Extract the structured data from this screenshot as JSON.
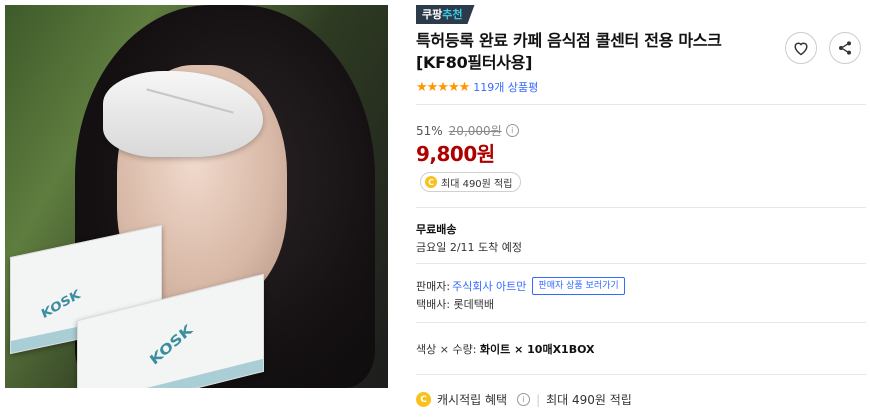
{
  "product_image": {
    "brand_text": "KOSK"
  },
  "badge": {
    "prefix": "쿠팡",
    "suffix": "추천"
  },
  "title": "특허등록 완료 카페 음식점 콜센터 전용 마스크 [KF80필터사용]",
  "actions": {
    "heart_icon": "heart-icon",
    "share_icon": "share-icon"
  },
  "rating": {
    "stars": "★★★★★",
    "review_count": "119개 상품평",
    "star_color": "#ff9600"
  },
  "price": {
    "discount_rate": "51%",
    "original_price": "20,000원",
    "info_icon": "ⓘ",
    "sale_price": "9,800원",
    "sale_color": "#ae0000"
  },
  "reward": {
    "coin_glyph": "C",
    "text": "최대 490원 적립"
  },
  "shipping": {
    "label": "무료배송",
    "arrival": "금요일 2/11 도착 예정"
  },
  "seller": {
    "label": "판매자:",
    "name": "주식회사 아트만",
    "button": "판매자 상품 보러가기",
    "courier": "택배사: 롯데택배"
  },
  "option": {
    "label": "색상 × 수량:",
    "value": "화이트 × 10매X1BOX"
  },
  "cash": {
    "coin_glyph": "C",
    "label": "캐시적립 혜택",
    "info_icon": "ⓘ",
    "divider": "|",
    "max_text": "최대 490원 적립"
  },
  "colors": {
    "accent_blue": "#346aff",
    "badge_bg": "#2b3b49"
  }
}
